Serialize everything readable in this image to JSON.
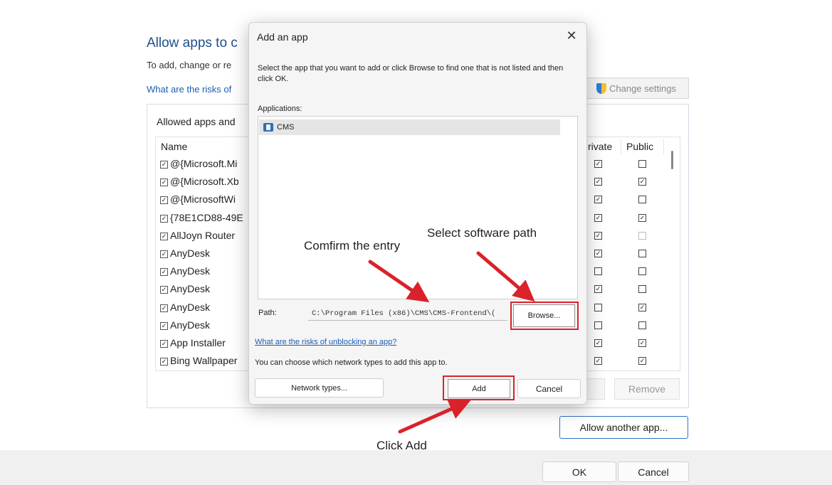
{
  "background": {
    "title": "Allow apps to c",
    "subtitle": "To add, change or re",
    "risks_link": "What are the risks of",
    "change_settings": "Change settings",
    "group_label": "Allowed apps and",
    "columns": {
      "name": "Name",
      "private": "rivate",
      "public": "Public"
    },
    "rows": [
      {
        "name": "@{Microsoft.Mi",
        "private": true,
        "public": false
      },
      {
        "name": "@{Microsoft.Xb",
        "private": true,
        "public": true
      },
      {
        "name": "@{MicrosoftWi",
        "private": true,
        "public": false
      },
      {
        "name": "{78E1CD88-49E",
        "private": true,
        "public": true
      },
      {
        "name": "AllJoyn Router",
        "private": true,
        "public": false
      },
      {
        "name": "AnyDesk",
        "private": true,
        "public": false
      },
      {
        "name": "AnyDesk",
        "private": false,
        "public": false
      },
      {
        "name": "AnyDesk",
        "private": true,
        "public": false
      },
      {
        "name": "AnyDesk",
        "private": false,
        "public": true
      },
      {
        "name": "AnyDesk",
        "private": false,
        "public": false
      },
      {
        "name": "App Installer",
        "private": true,
        "public": true
      },
      {
        "name": "Bing Wallpaper",
        "private": true,
        "public": true
      }
    ],
    "remove": "Remove",
    "allow_another": "Allow another app...",
    "ok": "OK",
    "cancel": "Cancel"
  },
  "dialog": {
    "title": "Add an app",
    "close_icon": "close-icon",
    "description": "Select the app that you want to add or click Browse to find one that is not listed and then click OK.",
    "applications_label": "Applications:",
    "applications": [
      {
        "name": "CMS",
        "icon": "cms-app-icon"
      }
    ],
    "path_label": "Path:",
    "path_value": "C:\\Program Files (x86)\\CMS\\CMS-Frontend\\(",
    "browse": "Browse...",
    "risks_link": "What are the risks of unblocking an app?",
    "network_text": "You can choose which network types to add this app to.",
    "network_types": "Network types...",
    "add": "Add",
    "cancel": "Cancel"
  },
  "annotations": {
    "confirm": "Comfirm the entry",
    "select_path": "Select software path",
    "click_add": "Click Add",
    "highlight_color": "#d9222a"
  }
}
